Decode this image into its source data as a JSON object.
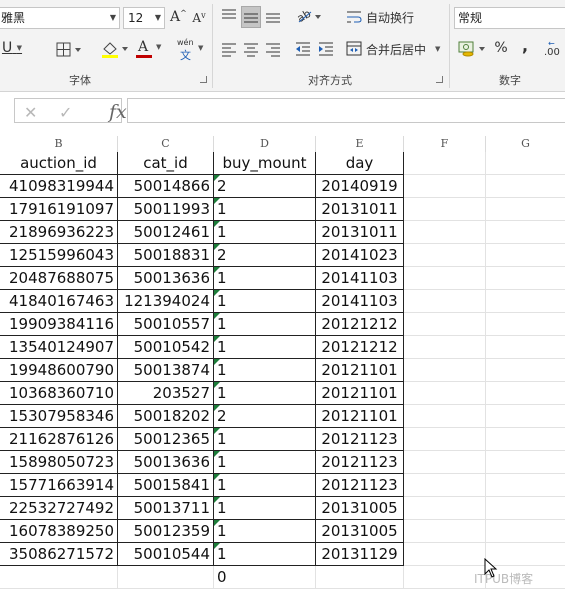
{
  "ribbon": {
    "font_name": "雅黑",
    "font_size": "12",
    "num_format": "常规",
    "wrap_text": "自动换行",
    "merge_center": "合并后居中",
    "group_font": "字体",
    "group_align": "对齐方式",
    "group_number": "数字",
    "grow_font": "A",
    "shrink_font": "A",
    "underline": "U",
    "font_color_glyph": "A",
    "phonetic_top": "wén",
    "phonetic_bottom": "文",
    "percent": "%",
    "comma": ",",
    "decimal": ".00"
  },
  "formula_bar": {
    "cancel": "✕",
    "enter": "✓",
    "fx": "fx",
    "value": ""
  },
  "columns": [
    "B",
    "C",
    "D",
    "E",
    "F",
    "G"
  ],
  "table": {
    "headers": [
      "auction_id",
      "cat_id",
      "buy_mount",
      "day"
    ],
    "rows": [
      [
        "41098319944",
        "50014866",
        "2",
        "20140919"
      ],
      [
        "17916191097",
        "50011993",
        "1",
        "20131011"
      ],
      [
        "21896936223",
        "50012461",
        "1",
        "20131011"
      ],
      [
        "12515996043",
        "50018831",
        "2",
        "20141023"
      ],
      [
        "20487688075",
        "50013636",
        "1",
        "20141103"
      ],
      [
        "41840167463",
        "121394024",
        "1",
        "20141103"
      ],
      [
        "19909384116",
        "50010557",
        "1",
        "20121212"
      ],
      [
        "13540124907",
        "50010542",
        "1",
        "20121212"
      ],
      [
        "19948600790",
        "50013874",
        "1",
        "20121101"
      ],
      [
        "10368360710",
        "203527",
        "1",
        "20121101"
      ],
      [
        "15307958346",
        "50018202",
        "2",
        "20121101"
      ],
      [
        "21162876126",
        "50012365",
        "1",
        "20121123"
      ],
      [
        "15898050723",
        "50013636",
        "1",
        "20121123"
      ],
      [
        "15771663914",
        "50015841",
        "1",
        "20121123"
      ],
      [
        "22532727492",
        "50013711",
        "1",
        "20131005"
      ],
      [
        "16078389250",
        "50012359",
        "1",
        "20131005"
      ],
      [
        "35086271572",
        "50010544",
        "1",
        "20131129"
      ]
    ],
    "footer_value": "0"
  },
  "watermark": "ITPUB博客"
}
